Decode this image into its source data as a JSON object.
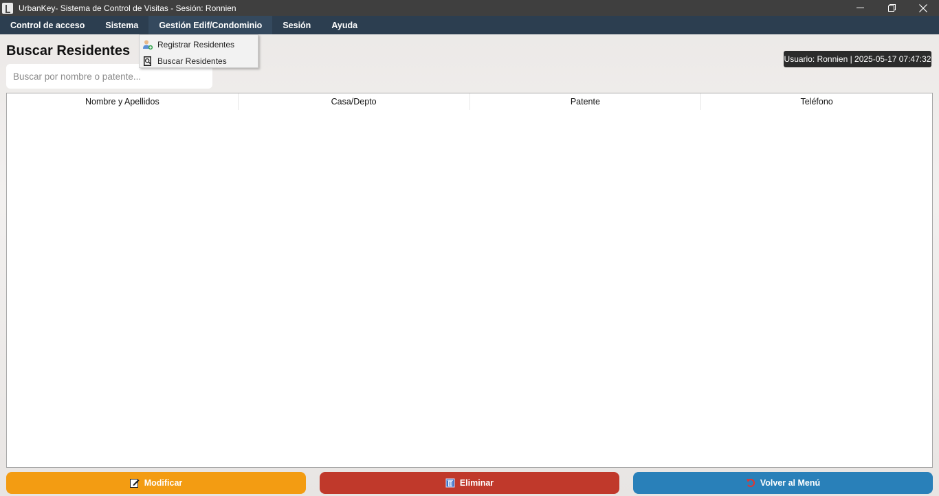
{
  "window": {
    "title": "UrbanKey- Sistema de Control de Visitas - Sesión: Ronnien"
  },
  "menubar": {
    "items": [
      {
        "label": "Control de acceso"
      },
      {
        "label": "Sistema"
      },
      {
        "label": "Gestión Edif/Condominio"
      },
      {
        "label": "Sesión"
      },
      {
        "label": "Ayuda"
      }
    ]
  },
  "dropdown": {
    "items": [
      {
        "label": "Registrar Residentes",
        "icon": "user-add-icon"
      },
      {
        "label": "Buscar Residentes",
        "icon": "search-document-icon"
      }
    ]
  },
  "page": {
    "title": "Buscar Residentes"
  },
  "search": {
    "placeholder": "Buscar por nombre o patente...",
    "value": ""
  },
  "user_badge": {
    "text": "Usuario: Ronnien | 2025-05-17 07:47:32"
  },
  "table": {
    "columns": [
      "Nombre y Apellidos",
      "Casa/Depto",
      "Patente",
      "Teléfono"
    ],
    "rows": []
  },
  "actions": {
    "modify_label": "Modificar",
    "delete_label": "Eliminar",
    "back_label": "Volver al Menú"
  },
  "colors": {
    "menubar": "#2c3e50",
    "modify": "#f39c12",
    "delete": "#c0392b",
    "back": "#2980b9"
  }
}
